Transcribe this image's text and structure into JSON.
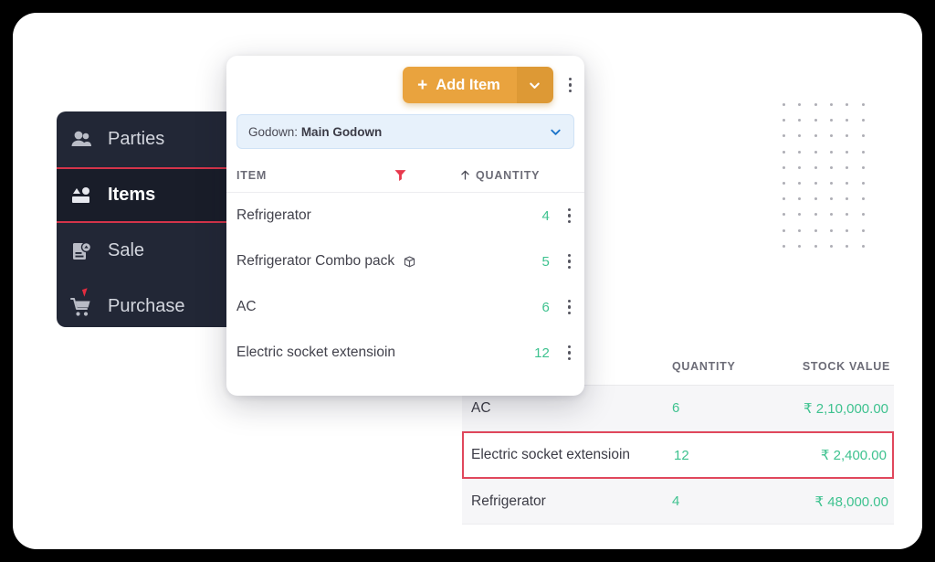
{
  "sidebar": {
    "items": [
      {
        "label": "Parties",
        "icon": "people-icon",
        "active": false
      },
      {
        "label": "Items",
        "icon": "items-icon",
        "active": true
      },
      {
        "label": "Sale",
        "icon": "document-icon",
        "active": false
      },
      {
        "label": "Purchase",
        "icon": "cart-icon",
        "active": false
      }
    ]
  },
  "popup": {
    "add_button": {
      "label": "Add Item",
      "plus": "+",
      "caret_icon": "chevron-down-icon"
    },
    "overflow_icon": "kebab-menu-icon",
    "godown": {
      "prefix": "Godown:",
      "value": "Main Godown",
      "caret_icon": "chevron-down-icon"
    },
    "columns": {
      "item": "ITEM",
      "filter_icon": "filter-icon",
      "quantity": "QUANTITY",
      "sort_icon": "arrow-up-icon"
    },
    "rows": [
      {
        "name": "Refrigerator",
        "qty": "4",
        "badge_icon": ""
      },
      {
        "name": "Refrigerator Combo pack",
        "qty": "5",
        "badge_icon": "box-icon"
      },
      {
        "name": "AC",
        "qty": "6",
        "badge_icon": ""
      },
      {
        "name": "Electric socket extensioin",
        "qty": "12",
        "badge_icon": ""
      }
    ]
  },
  "stock_table": {
    "columns": {
      "name": "",
      "quantity": "QUANTITY",
      "stock_value": "STOCK VALUE"
    },
    "rows": [
      {
        "name": "AC",
        "qty": "6",
        "value": "₹ 2,10,000.00",
        "highlight": false
      },
      {
        "name": "Electric socket extensioin",
        "qty": "12",
        "value": "₹ 2,400.00",
        "highlight": true
      },
      {
        "name": "Refrigerator",
        "qty": "4",
        "value": "₹ 48,000.00",
        "highlight": false
      }
    ]
  },
  "colors": {
    "accent_orange": "#e9a33e",
    "accent_orange_dark": "#dd9935",
    "quantity_green": "#3ec28f",
    "highlight_red": "#e0475c",
    "filter_red": "#e8394d",
    "sidebar_bg": "#222736",
    "sidebar_active_bg": "#191d29",
    "sidebar_rule": "#d4344a",
    "godown_bg": "#e7f1fb",
    "row_bg": "#f6f6f8"
  }
}
